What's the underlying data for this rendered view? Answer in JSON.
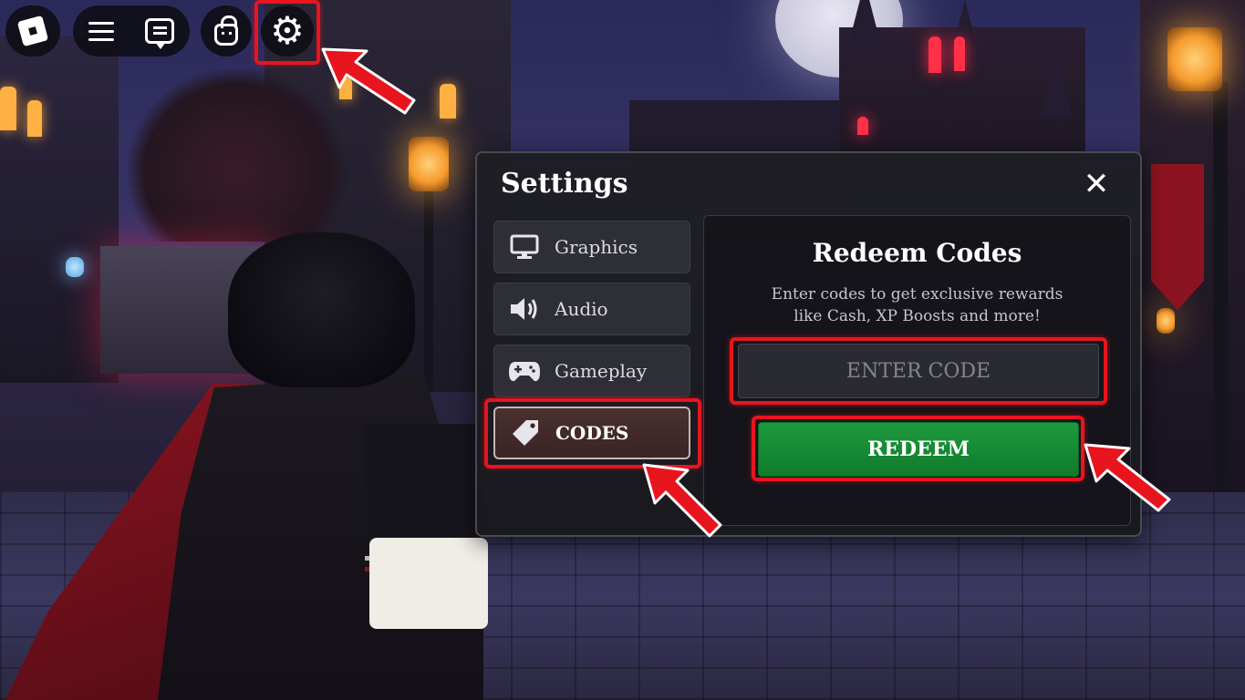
{
  "topbar": {
    "logo_icon": "roblox-logo-icon",
    "menu_icon": "hamburger-menu-icon",
    "chat_icon": "chat-icon",
    "backpack_icon": "backpack-icon",
    "settings_icon": "gear-icon",
    "settings_glyph": "⚙"
  },
  "settings": {
    "title": "Settings",
    "close_glyph": "✕",
    "tabs": [
      {
        "label": "Graphics",
        "icon": "monitor-icon"
      },
      {
        "label": "Audio",
        "icon": "speaker-icon"
      },
      {
        "label": "Gameplay",
        "icon": "gamepad-icon"
      },
      {
        "label": "CODES",
        "icon": "tag-icon",
        "active": true
      }
    ]
  },
  "redeem": {
    "title": "Redeem Codes",
    "description_line1": "Enter codes to get exclusive rewards",
    "description_line2": "like Cash, XP Boosts and more!",
    "input_placeholder": "ENTER CODE",
    "button_label": "REDEEM"
  },
  "colors": {
    "highlight": "#e8141e",
    "redeem_green": "#1c9a3e",
    "panel_bg": "#1e1e24"
  }
}
